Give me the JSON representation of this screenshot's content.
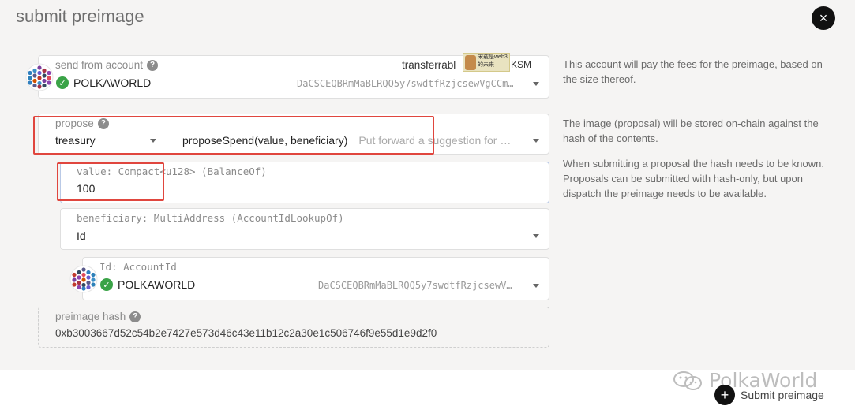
{
  "modal": {
    "title": "submit preimage",
    "close_label": "×"
  },
  "send_from": {
    "label": "send from account",
    "name": "POLKAWORLD",
    "address": "DaCSCEQBRmMaBLRQQ5y7swdtfRzjcsewVgCCm…",
    "balance_label": "transferrabl",
    "balance_unit": "KSM",
    "overlay_text_line1": "宋载是web3",
    "overlay_text_line2": "的未来"
  },
  "propose": {
    "label": "propose",
    "section": "treasury",
    "method": "proposeSpend(value, beneficiary)",
    "method_desc": "Put forward a suggestion for …"
  },
  "value_param": {
    "label": "value: Compact<u128> (BalanceOf)",
    "value": "100"
  },
  "beneficiary": {
    "label": "beneficiary: MultiAddress (AccountIdLookupOf)",
    "value": "Id"
  },
  "account_id": {
    "label": "Id: AccountId",
    "name": "POLKAWORLD",
    "address": "DaCSCEQBRmMaBLRQQ5y7swdtfRzjcsewV…"
  },
  "preimage_hash": {
    "label": "preimage hash",
    "value": "0xb3003667d52c54b2e7427e573d46c43e11b12c2a30e1c506746f9e55d1e9d2f0"
  },
  "help_texts": {
    "account": "This account will pay the fees for the preimage, based on the size thereof.",
    "proposal": "The image (proposal) will be stored on-chain against the hash of the contents.",
    "submitting": "When submitting a proposal the hash needs to be known. Proposals can be submitted with hash-only, but upon dispatch the preimage needs to be available."
  },
  "submit": {
    "label": "Submit preimage"
  },
  "watermark": {
    "text": "PolkaWorld"
  },
  "colors": {
    "accent": "#e0463e",
    "success": "#3aa347",
    "dark_button": "#111111"
  }
}
